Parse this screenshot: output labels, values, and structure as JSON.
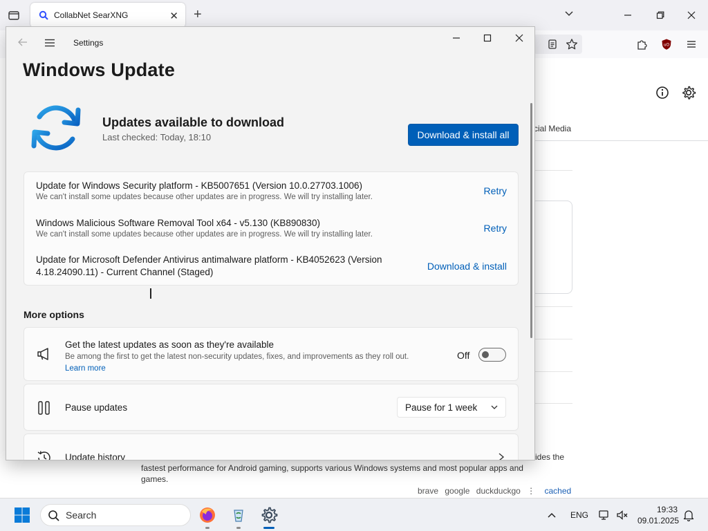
{
  "browser": {
    "tab_title": "CollabNet SearXNG",
    "new_tab_symbol": "+",
    "close_symbol": "✕",
    "category_partial": "cial Media",
    "snippet_line1": "ides the",
    "snippet_line2": "fastest performance for Android gaming, supports various Windows systems and most popular apps and",
    "snippet_line3": "games.",
    "engines": [
      "brave",
      "google",
      "duckduckgo"
    ],
    "engines_separator": "⋮",
    "cached_label": "cached"
  },
  "settings": {
    "window_title": "Settings",
    "page_heading": "Windows Update",
    "status_title": "Updates available to download",
    "last_checked": "Last checked: Today, 18:10",
    "primary_button": "Download & install all",
    "updates": [
      {
        "name": "Update for Windows Security platform - KB5007651 (Version 10.0.27703.1006)",
        "status": "We can't install some updates because other updates are in progress. We will try installing later.",
        "action": "Retry"
      },
      {
        "name": "Windows Malicious Software Removal Tool x64 - v5.130 (KB890830)",
        "status": "We can't install some updates because other updates are in progress. We will try installing later.",
        "action": "Retry"
      },
      {
        "name_line1": "Update for Microsoft Defender Antivirus antimalware platform - KB4052623 (Version",
        "name_line2": "4.18.24090.11) - Current Channel (Staged)",
        "action": "Download & install"
      }
    ],
    "more_options_label": "More options",
    "latest_updates": {
      "title": "Get the latest updates as soon as they're available",
      "description": "Be among the first to get the latest non-security updates, fixes, and improvements as they roll out.",
      "link": "Learn more",
      "toggle_state": "Off",
      "toggle_on": false
    },
    "pause_updates": {
      "title": "Pause updates",
      "selected": "Pause for 1 week"
    },
    "update_history": {
      "title": "Update history"
    }
  },
  "taskbar": {
    "search_placeholder": "Search",
    "language": "ENG",
    "time": "19:33",
    "date": "09.01.2025"
  },
  "colors": {
    "accent": "#005fb8",
    "window_bg": "#f3f3f3",
    "card_bg": "#fbfbfb"
  }
}
